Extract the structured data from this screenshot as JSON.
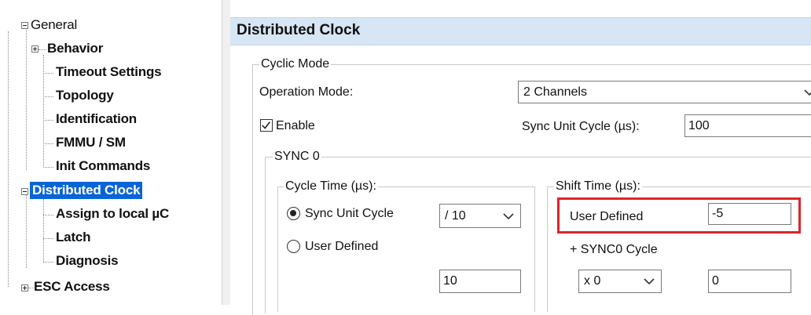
{
  "tree": {
    "general": "General",
    "behavior": "Behavior",
    "timeout_settings": "Timeout Settings",
    "topology": "Topology",
    "identification": "Identification",
    "fmmu_sm": "FMMU / SM",
    "init_commands": "Init Commands",
    "distributed_clock": "Distributed Clock",
    "assign_local": "Assign to local µC",
    "latch": "Latch",
    "diagnosis": "Diagnosis",
    "esc_access": "ESC Access"
  },
  "panel": {
    "title": "Distributed Clock",
    "cyclic_mode": {
      "legend": "Cyclic Mode",
      "operation_mode_label": "Operation Mode:",
      "operation_mode_value": "2 Channels",
      "enable_label": "Enable",
      "enable_checked": true,
      "sync_unit_cycle_label": "Sync Unit Cycle (µs):",
      "sync_unit_cycle_value": "100"
    },
    "sync0": {
      "legend": "SYNC 0",
      "cycle_time": {
        "legend": "Cycle Time (µs):",
        "sync_unit_cycle_label": "Sync Unit Cycle",
        "divider_value": "/ 10",
        "user_defined_label": "User Defined",
        "cycle_value": "10"
      },
      "shift_time": {
        "legend": "Shift Time (µs):",
        "user_defined_label": "User Defined",
        "user_defined_value": "-5",
        "sync0_cycle_label": "+ SYNC0 Cycle",
        "multiplier_value": "x 0",
        "offset_value": "0"
      }
    }
  },
  "colors": {
    "selection": "#0a64d6",
    "header_bg": "#d6e6f4",
    "highlight": "#e0242a"
  }
}
